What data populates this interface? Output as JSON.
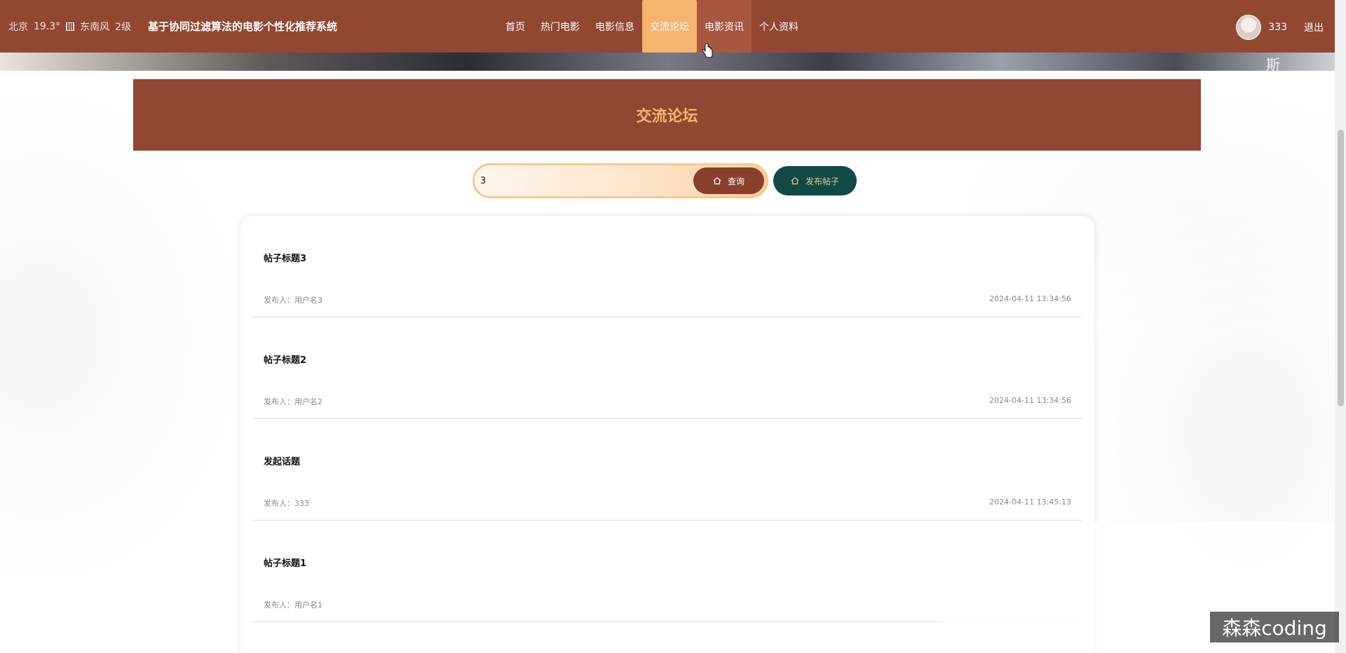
{
  "header": {
    "weather": {
      "city": "北京",
      "temperature": "19.3°",
      "wind": "东南风",
      "level": "2级"
    },
    "site_title": "基于协同过滤算法的电影个性化推荐系统",
    "nav": [
      {
        "label": "首页",
        "state": "normal"
      },
      {
        "label": "热门电影",
        "state": "normal"
      },
      {
        "label": "电影信息",
        "state": "normal"
      },
      {
        "label": "交流论坛",
        "state": "active"
      },
      {
        "label": "电影资讯",
        "state": "hover"
      },
      {
        "label": "个人资料",
        "state": "normal"
      }
    ],
    "username": "333",
    "logout_label": "退出"
  },
  "banner": {
    "glyph": "斯"
  },
  "forum": {
    "title": "交流论坛"
  },
  "search": {
    "value": "3",
    "query_label": "查询",
    "post_label": "发布帖子"
  },
  "posts": [
    {
      "title": "帖子标题3",
      "author": "发布人：用户名3",
      "time": "2024-04-11 13:34:56"
    },
    {
      "title": "帖子标题2",
      "author": "发布人：用户名2",
      "time": "2024-04-11 13:34:56"
    },
    {
      "title": "发起话题",
      "author": "发布人：333",
      "time": "2024-04-11 13:45:13"
    },
    {
      "title": "帖子标题1",
      "author": "发布人：用户名1",
      "time": ""
    }
  ],
  "watermark": "森森coding",
  "colors": {
    "header_bg": "#924731",
    "accent": "#f6b470",
    "post_button": "#0f4a46"
  }
}
